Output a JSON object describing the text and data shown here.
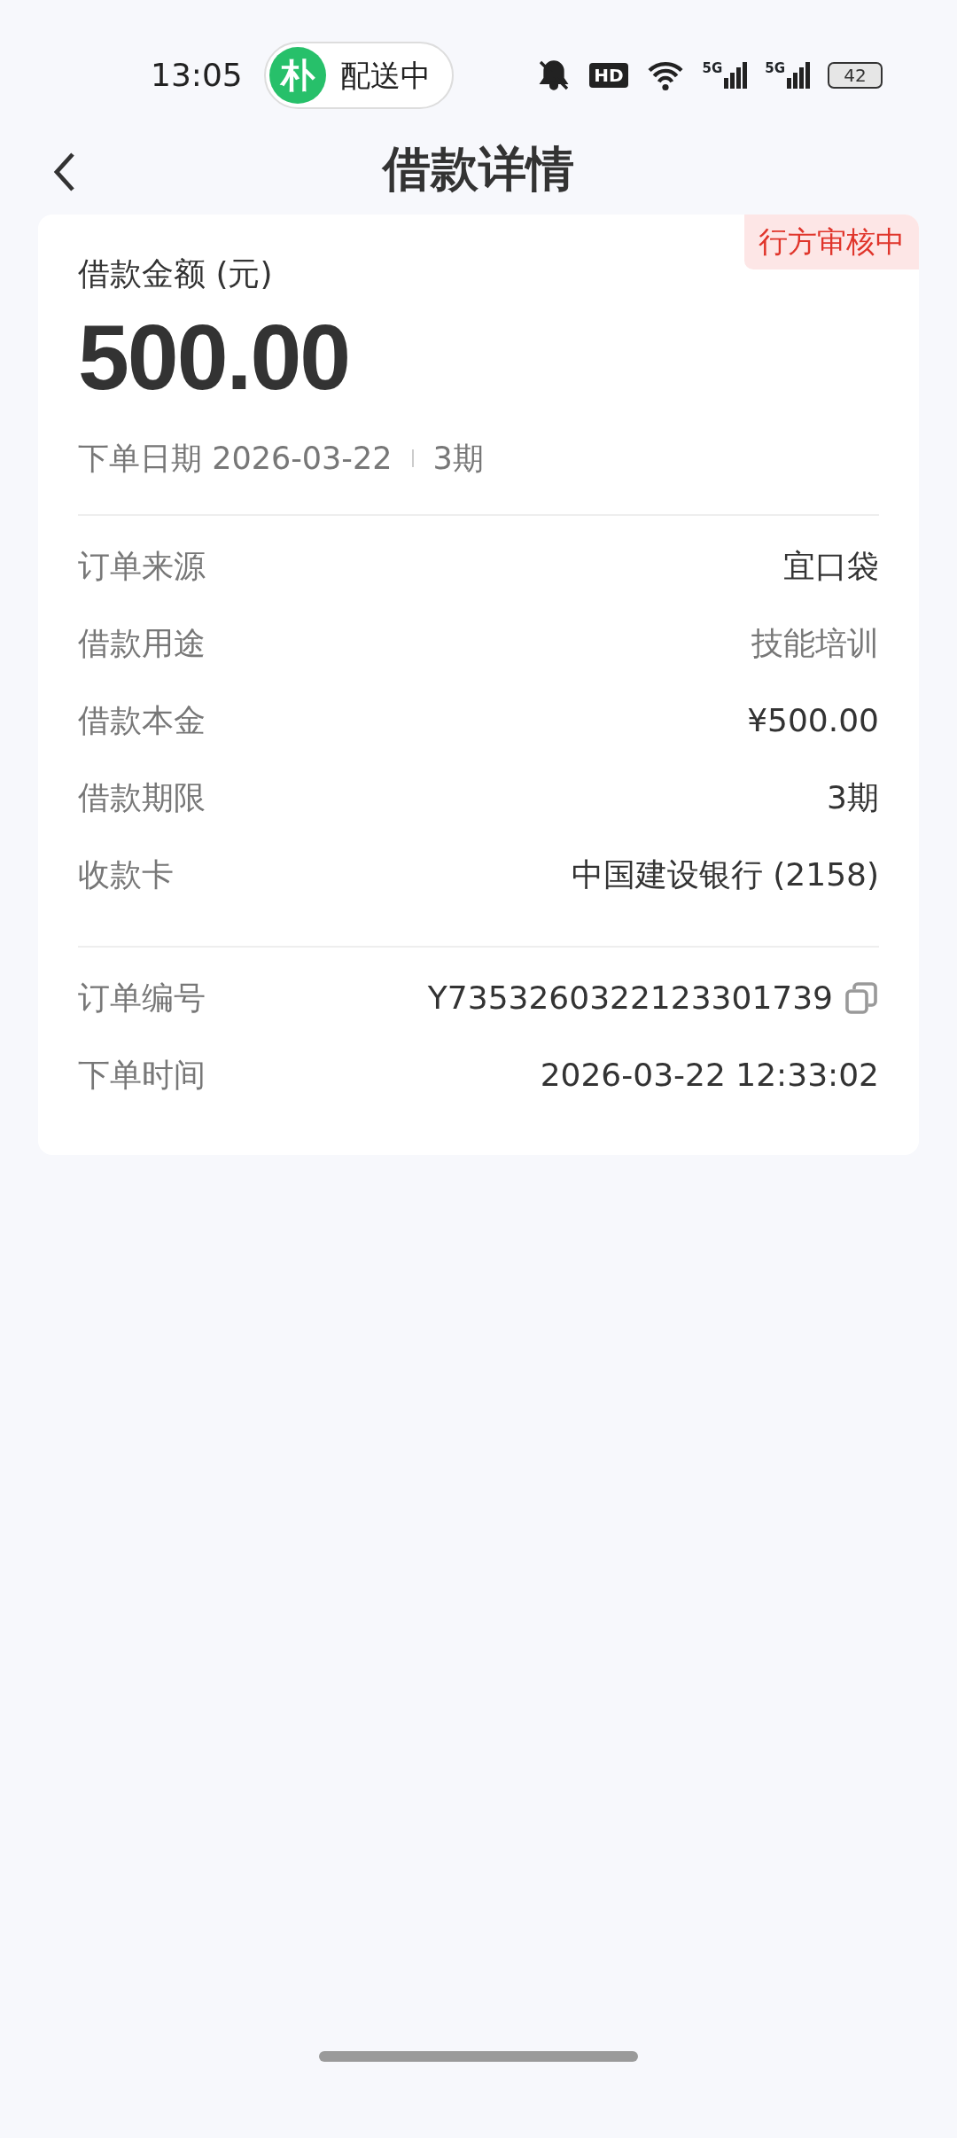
{
  "status_bar": {
    "time": "13:05",
    "activity": {
      "avatar": "朴",
      "text": "配送中"
    },
    "hd_label": "HD",
    "sim_labels": [
      "5G",
      "5G"
    ],
    "battery": "42"
  },
  "header": {
    "title": "借款详情"
  },
  "summary": {
    "status_badge": "行方审核中",
    "amount_label": "借款金额 (元)",
    "amount": "500.00",
    "order_date": "下单日期 2026-03-22",
    "term": "3期"
  },
  "details": [
    {
      "label": "订单来源",
      "value": "宜口袋",
      "emphasis": true
    },
    {
      "label": "借款用途",
      "value": "技能培训",
      "emphasis": false
    },
    {
      "label": "借款本金",
      "value": "¥500.00",
      "emphasis": true
    },
    {
      "label": "借款期限",
      "value": "3期",
      "emphasis": true
    },
    {
      "label": "收款卡",
      "value": "中国建设银行 (2158)",
      "emphasis": true
    }
  ],
  "order": [
    {
      "label": "订单编号",
      "value": "Y7353260322123301739",
      "copyable": true
    },
    {
      "label": "下单时间",
      "value": "2026-03-22 12:33:02",
      "copyable": false
    }
  ]
}
